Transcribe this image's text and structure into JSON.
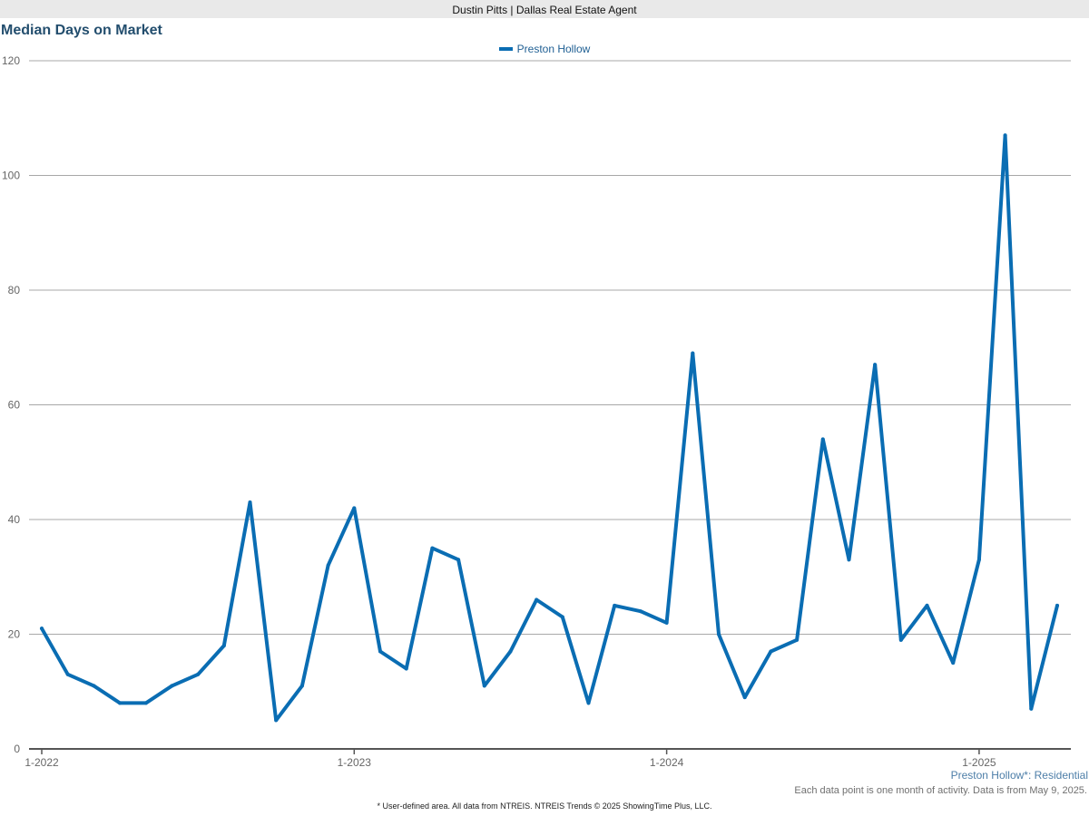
{
  "header": {
    "agent_line": "Dustin Pitts | Dallas Real Estate Agent"
  },
  "footer": {
    "area_label": "Preston Hollow*: Residential",
    "note": "Each data point is one month of activity. Data is from May 9, 2025.",
    "source": "* User-defined area. All data from NTREIS. NTREIS Trends © 2025 ShowingTime Plus, LLC."
  },
  "colors": {
    "series": "#0a6db3",
    "title": "#234e6e",
    "grid": "#a8a8a8"
  },
  "chart_data": {
    "type": "line",
    "title": "Median Days on Market",
    "xlabel": "",
    "ylabel": "",
    "ylim": [
      0,
      120
    ],
    "yticks": [
      0,
      20,
      40,
      60,
      80,
      100,
      120
    ],
    "xtick_labels": [
      {
        "label": "1-2022",
        "index": 0
      },
      {
        "label": "1-2023",
        "index": 12
      },
      {
        "label": "1-2024",
        "index": 24
      },
      {
        "label": "1-2025",
        "index": 36
      }
    ],
    "grid": true,
    "legend_position": "top-center",
    "x": [
      "2022-01",
      "2022-02",
      "2022-03",
      "2022-04",
      "2022-05",
      "2022-06",
      "2022-07",
      "2022-08",
      "2022-09",
      "2022-10",
      "2022-11",
      "2022-12",
      "2023-01",
      "2023-02",
      "2023-03",
      "2023-04",
      "2023-05",
      "2023-06",
      "2023-07",
      "2023-08",
      "2023-09",
      "2023-10",
      "2023-11",
      "2023-12",
      "2024-01",
      "2024-02",
      "2024-03",
      "2024-04",
      "2024-05",
      "2024-06",
      "2024-07",
      "2024-08",
      "2024-09",
      "2024-10",
      "2024-11",
      "2024-12",
      "2025-01",
      "2025-02",
      "2025-03",
      "2025-04"
    ],
    "series": [
      {
        "name": "Preston Hollow",
        "values": [
          21,
          13,
          11,
          8,
          8,
          11,
          13,
          18,
          43,
          5,
          11,
          32,
          42,
          17,
          14,
          35,
          33,
          11,
          17,
          26,
          23,
          8,
          25,
          24,
          22,
          69,
          20,
          9,
          17,
          19,
          54,
          33,
          67,
          19,
          25,
          15,
          33,
          107,
          7,
          25
        ]
      }
    ]
  }
}
